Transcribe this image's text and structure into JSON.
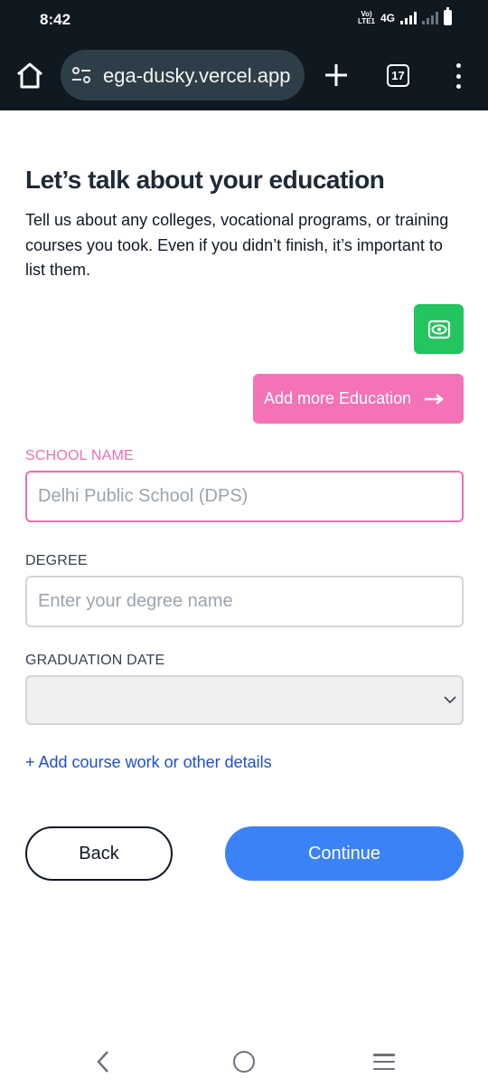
{
  "status_bar": {
    "time": "8:42",
    "volte": "Vo))\nLTE1",
    "network": "4G"
  },
  "browser": {
    "url": "ega-dusky.vercel.app",
    "tab_count": "17"
  },
  "page": {
    "title": "Let’s talk about your education",
    "description": "Tell us about any colleges, vocational programs, or training courses you took. Even if you didn’t finish, it’s important to list them.",
    "add_more_label": "Add more Education",
    "school": {
      "label": "SCHOOL NAME",
      "placeholder": "Delhi Public School (DPS)",
      "value": ""
    },
    "degree": {
      "label": "DEGREE",
      "placeholder": "Enter your degree name",
      "value": ""
    },
    "graduation": {
      "label": "GRADUATION DATE",
      "value": ""
    },
    "add_course_label": "+ Add course work or other details",
    "back_label": "Back",
    "continue_label": "Continue"
  },
  "colors": {
    "accent_green": "#22c55e",
    "accent_pink": "#f472b6",
    "accent_blue": "#3b82f6",
    "link_blue": "#1d4ed8"
  }
}
